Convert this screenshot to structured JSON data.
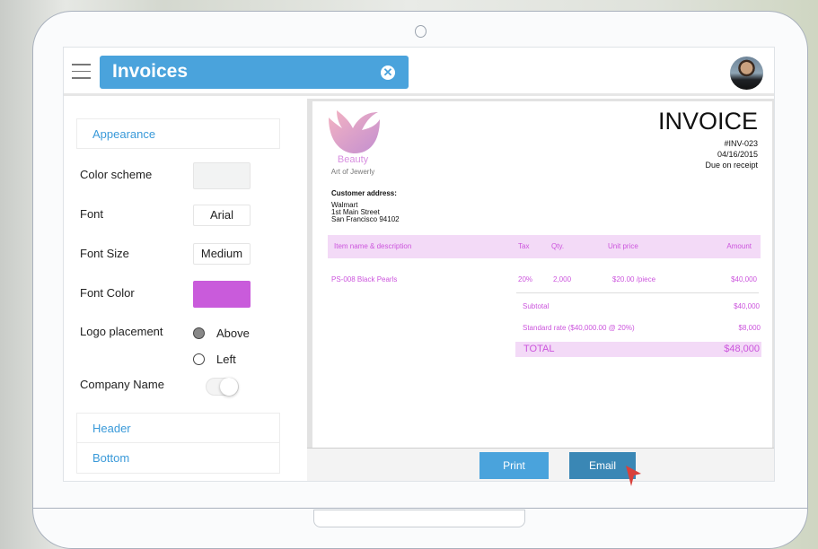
{
  "header": {
    "title": "Invoices",
    "menu_icon": "hamburger-icon",
    "clear_icon": "close-circle-icon"
  },
  "sidebar": {
    "sections": {
      "appearance": "Appearance",
      "header": "Header",
      "bottom": "Bottom"
    },
    "color_scheme": {
      "label": "Color scheme",
      "value_color": "#f2f3f3"
    },
    "font": {
      "label": "Font",
      "value": "Arial"
    },
    "font_size": {
      "label": "Font Size",
      "value": "Medium"
    },
    "font_color": {
      "label": "Font Color",
      "value_color": "#c95bdb"
    },
    "logo_placement": {
      "label": "Logo placement",
      "options": [
        {
          "label": "Above",
          "selected": true
        },
        {
          "label": "Left",
          "selected": false
        }
      ]
    },
    "company_name": {
      "label": "Company Name",
      "enabled": false
    }
  },
  "invoice": {
    "company": {
      "name": "Beauty",
      "tagline": "Art of Jewerly"
    },
    "title": "INVOICE",
    "number": "#INV-023",
    "date": "04/16/2015",
    "terms": "Due on receipt",
    "customer": {
      "label": "Customer address:",
      "lines": [
        "Walmart",
        "1st Main Street",
        "San Francisco 94102"
      ]
    },
    "columns": [
      "Item name & description",
      "Tax",
      "Qty.",
      "Unit price",
      "Amount"
    ],
    "items": [
      {
        "name": "PS-008 Black Pearls",
        "tax": "20%",
        "qty": "2,000",
        "unit_price": "$20.00 /piece",
        "amount": "$40,000"
      }
    ],
    "subtotal": {
      "label": "Subtotal",
      "value": "$40,000"
    },
    "tax_line": {
      "label": "Standard rate ($40,000.00 @ 20%)",
      "value": "$8,000"
    },
    "total": {
      "label": "TOTAL",
      "value": "$48,000"
    }
  },
  "actions": {
    "print": "Print",
    "email": "Email"
  },
  "colors": {
    "accent": "#4aa3dc",
    "accent_dark": "#3a87b5",
    "invoice_text": "#cc55dd",
    "invoice_band": "#f3daf7"
  }
}
